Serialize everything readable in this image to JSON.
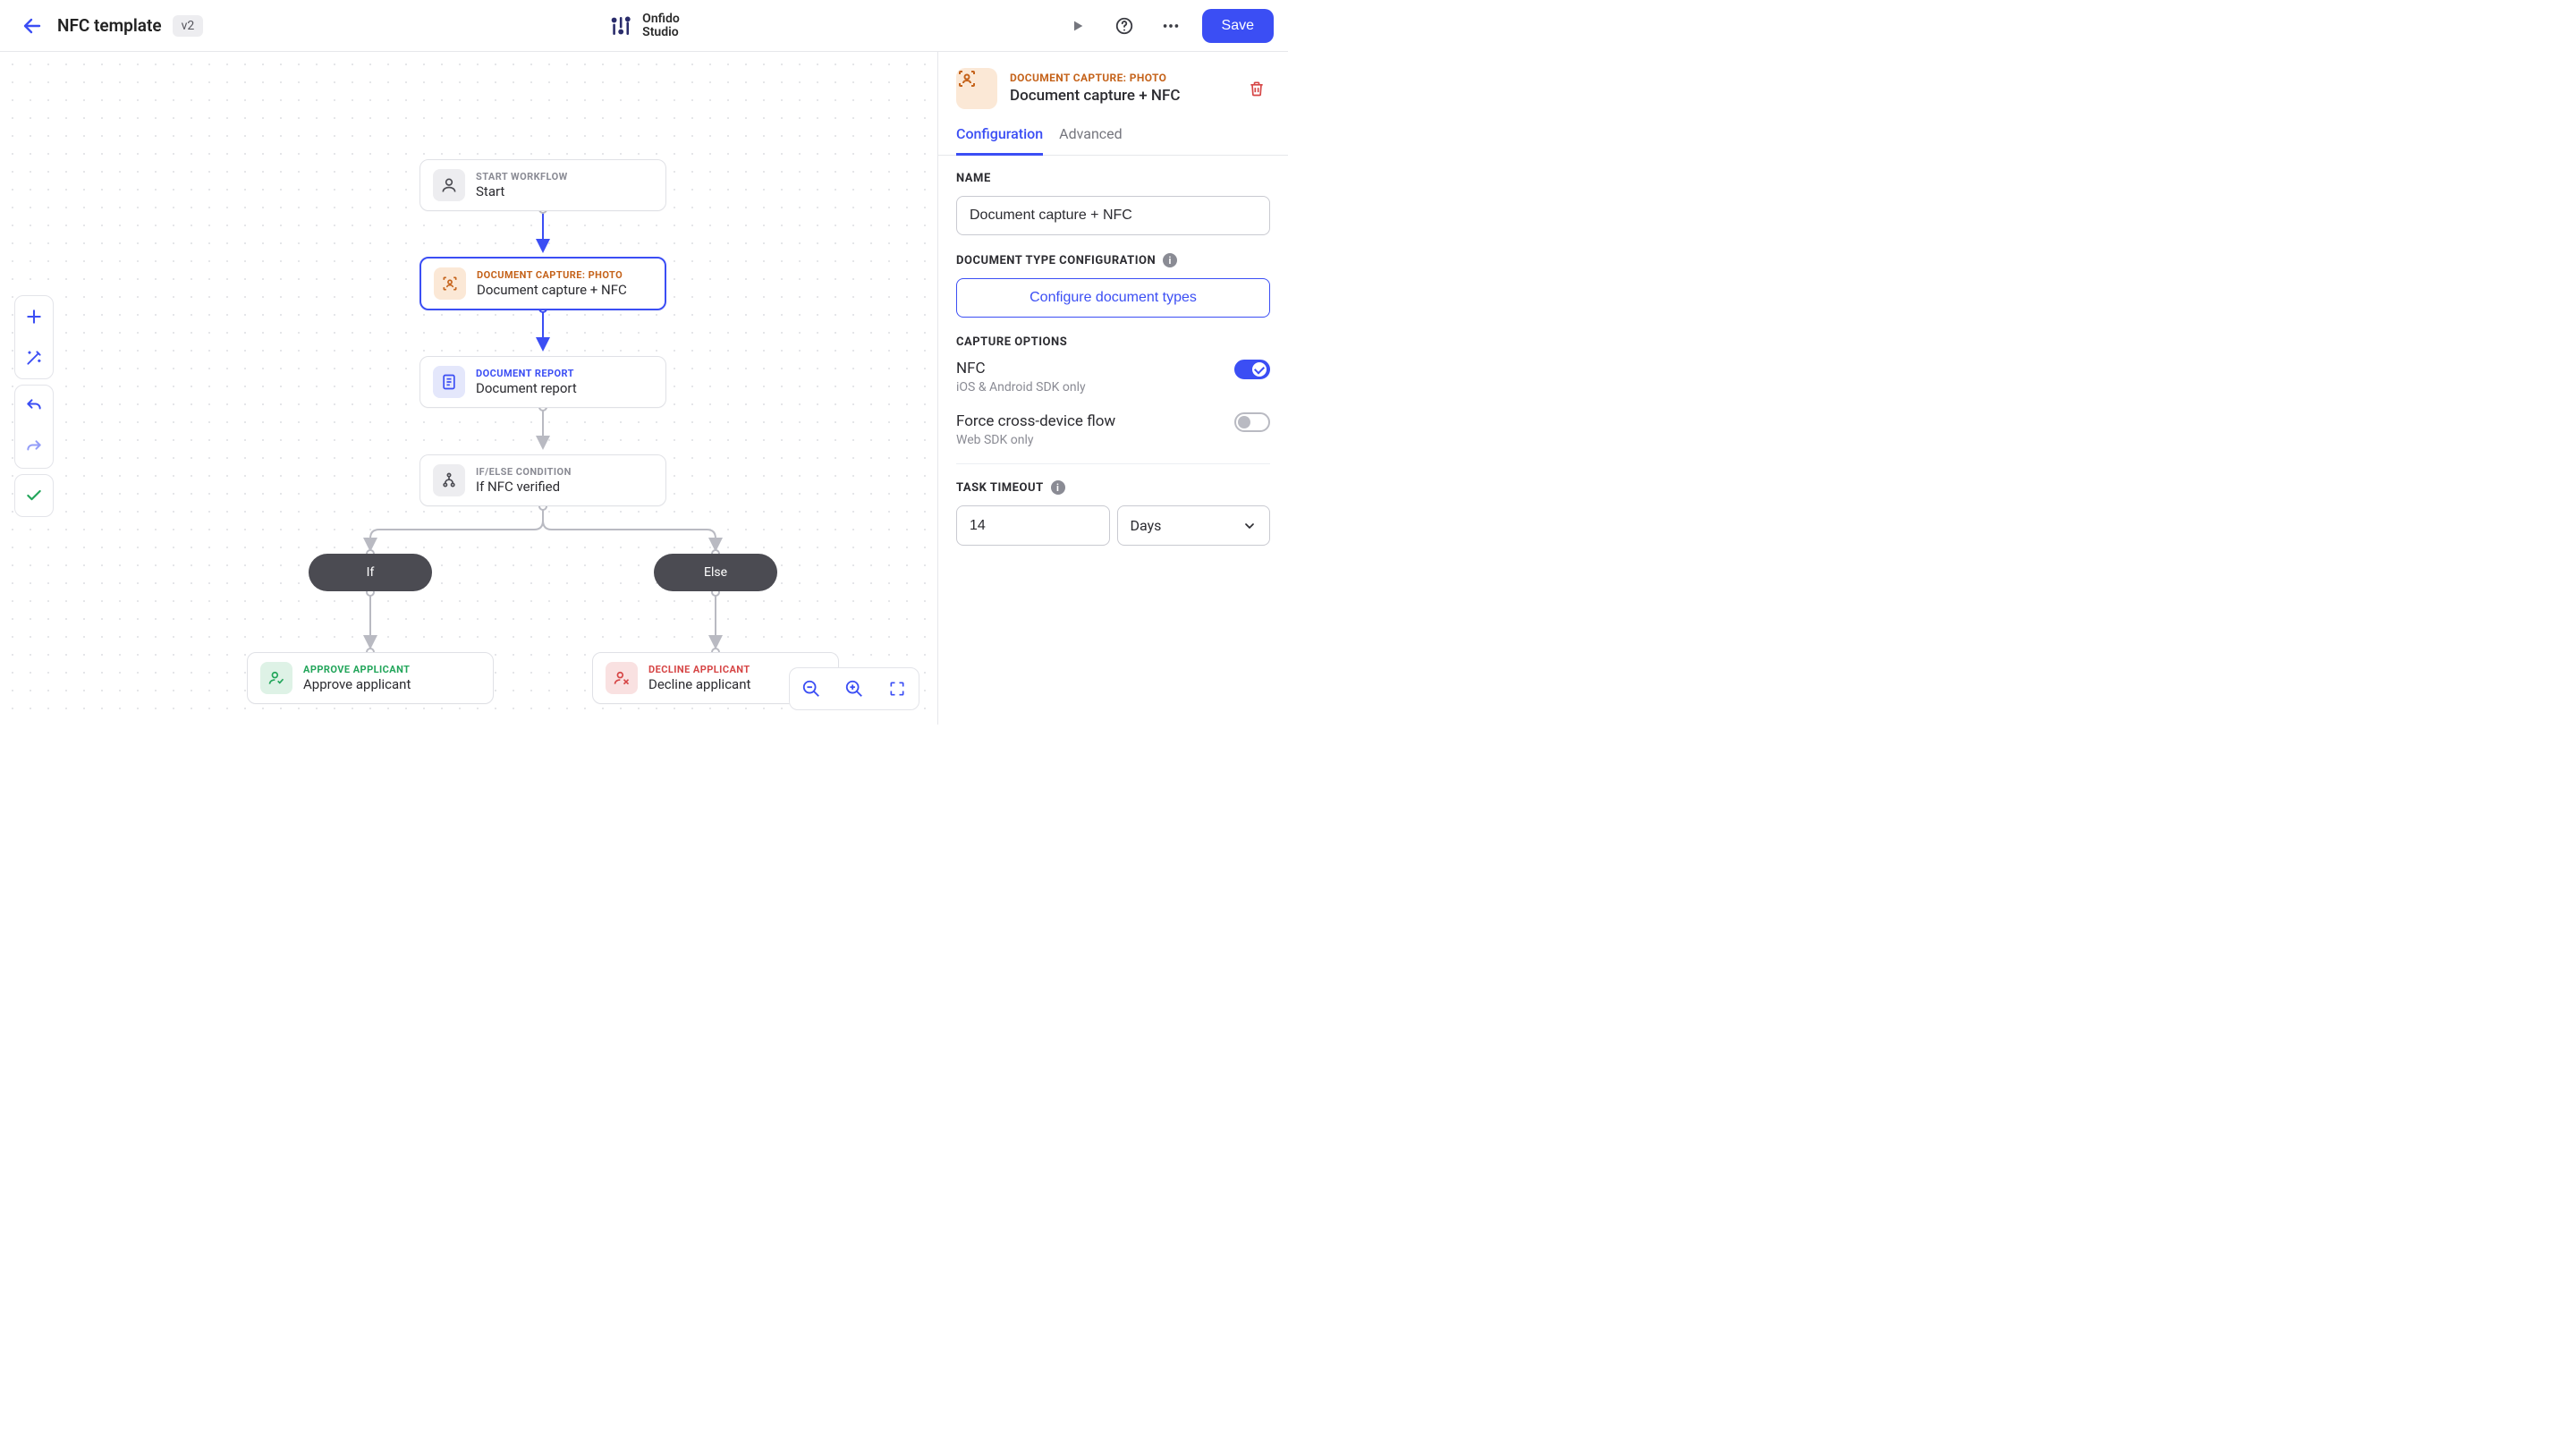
{
  "header": {
    "title": "NFC template",
    "version": "v2",
    "brand_top": "Onfido",
    "brand_bottom": "Studio",
    "save": "Save"
  },
  "nodes": {
    "start": {
      "type": "START WORKFLOW",
      "title": "Start"
    },
    "capture": {
      "type": "DOCUMENT CAPTURE: PHOTO",
      "title": "Document capture + NFC"
    },
    "report": {
      "type": "DOCUMENT REPORT",
      "title": "Document report"
    },
    "cond": {
      "type": "IF/ELSE CONDITION",
      "title": "If NFC verified"
    },
    "if_label": "If",
    "else_label": "Else",
    "approve": {
      "type": "APPROVE APPLICANT",
      "title": "Approve applicant"
    },
    "decline": {
      "type": "DECLINE APPLICANT",
      "title": "Decline applicant"
    }
  },
  "side": {
    "type": "DOCUMENT CAPTURE: PHOTO",
    "title": "Document capture + NFC",
    "tabs": {
      "config": "Configuration",
      "advanced": "Advanced"
    },
    "name_label": "NAME",
    "name_value": "Document capture + NFC",
    "doc_type_label": "DOCUMENT TYPE CONFIGURATION",
    "configure_btn": "Configure document types",
    "capture_label": "CAPTURE OPTIONS",
    "nfc_title": "NFC",
    "nfc_sub": "iOS & Android SDK only",
    "cross_title": "Force cross-device flow",
    "cross_sub": "Web SDK only",
    "timeout_label": "TASK TIMEOUT",
    "timeout_value": "14",
    "timeout_unit": "Days"
  }
}
